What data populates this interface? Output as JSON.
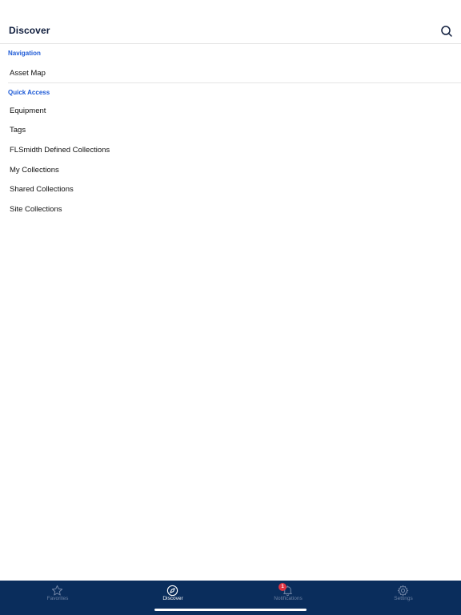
{
  "header": {
    "title": "Discover",
    "search_icon": "search-icon"
  },
  "navigation": {
    "label": "Navigation",
    "items": [
      {
        "label": "Asset Map"
      }
    ]
  },
  "quick_access": {
    "label": "Quick Access",
    "items": [
      {
        "label": "Equipment"
      },
      {
        "label": "Tags"
      },
      {
        "label": "FLSmidth Defined Collections"
      },
      {
        "label": "My Collections"
      },
      {
        "label": "Shared Collections"
      },
      {
        "label": "Site Collections"
      }
    ]
  },
  "tabbar": {
    "tabs": [
      {
        "label": "Favorites",
        "icon": "star-icon"
      },
      {
        "label": "Discover",
        "icon": "compass-icon",
        "active": true
      },
      {
        "label": "Notifications",
        "icon": "bell-icon",
        "badge": "1"
      },
      {
        "label": "Settings",
        "icon": "gear-icon"
      }
    ]
  },
  "colors": {
    "accent": "#1f5bd6",
    "tabbar_bg": "#0a2d5c",
    "badge": "#e03342",
    "title": "#0f1d3d"
  }
}
